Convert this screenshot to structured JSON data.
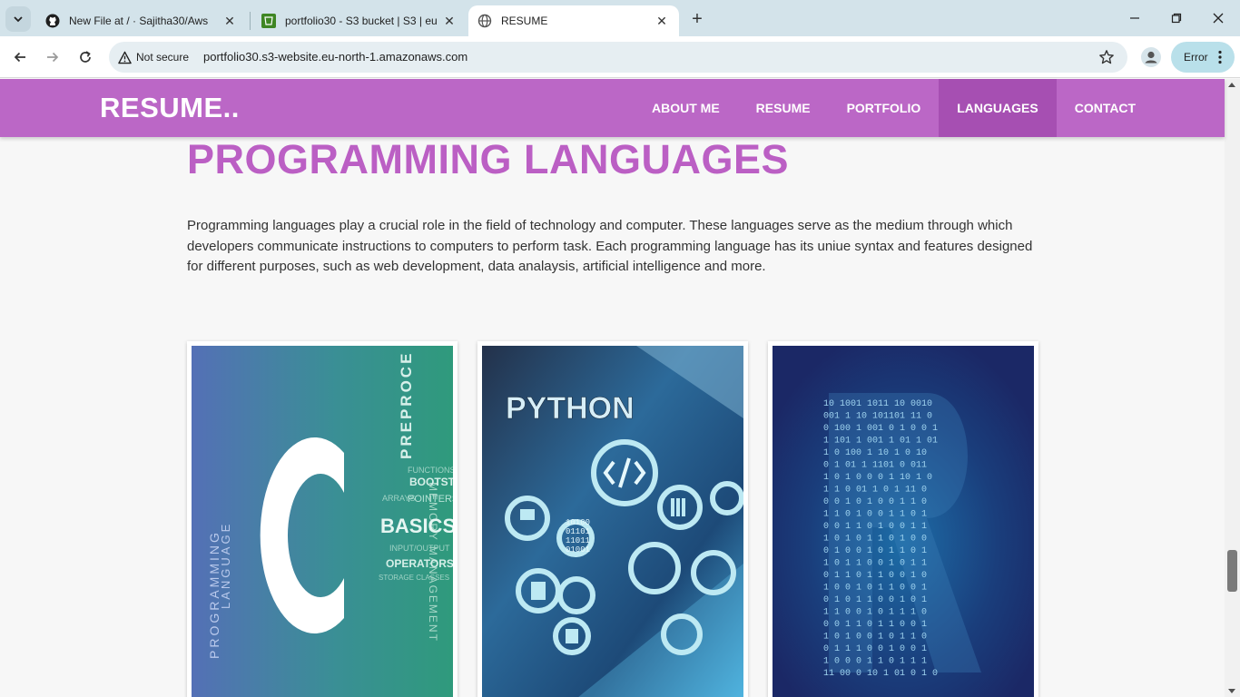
{
  "browser": {
    "tabs": [
      {
        "title": "New File at / · Sajitha30/Aws",
        "icon": "github-icon"
      },
      {
        "title": "portfolio30 - S3 bucket | S3 | eu",
        "icon": "aws-s3-icon"
      },
      {
        "title": "RESUME",
        "icon": "globe-icon"
      }
    ],
    "security_label": "Not secure",
    "url": "portfolio30.s3-website.eu-north-1.amazonaws.com",
    "error_label": "Error"
  },
  "site": {
    "brand": "RESUME..",
    "nav": [
      {
        "label": "ABOUT ME"
      },
      {
        "label": "RESUME"
      },
      {
        "label": "PORTFOLIO"
      },
      {
        "label": "LANGUAGES"
      },
      {
        "label": "CONTACT"
      }
    ],
    "active_nav": "LANGUAGES",
    "accent_color": "#bb67c6",
    "heading_color": "#bb5fc4"
  },
  "main": {
    "heading": "PROGRAMMING LANGUAGES",
    "intro": "Programming languages play a crucial role in the field of technology and computer. These languages serve as the medium through which developers communicate instructions to computers to perform task. Each programming language has its uniue syntax and features designed for different purposes, such as web development, data analaysis, artificial intelligence and more.",
    "cards": [
      {
        "image": "c-language-image",
        "texts": {
          "programming": "PROGRAMMING",
          "language": "LANGUAGE",
          "preprocessor": "PREPROCE",
          "functions": "FUNCTIONS",
          "bootstrap": "BOOTSTRAP",
          "arrays": "ARRAYS",
          "pointers": "POINTERS",
          "basics": "BASICS",
          "input_output": "INPUT/OUTPUT",
          "operators": "OPERATORS",
          "storage": "STORAGE CLASSES",
          "memory": "MEMORY MANAGEMENT"
        }
      },
      {
        "image": "python-gears-image",
        "texts": {
          "python": "PYTHON",
          "binary1": "10100",
          "binary2": "01101",
          "binary3": "11011",
          "binary4": "01001"
        }
      },
      {
        "image": "r-binary-image",
        "texts": {
          "rows": [
            "10 1001 1011 10 0010",
            "001 1 10 101101 11 0",
            "0 100 1 001 0 1 0 0 1",
            "1 101 1 001 1 01 1 01",
            "1 0 100 1 10 1 0 10",
            "0 1 01 1 1101 0 011",
            "1 0 1 0 0 0 1 10 1 0",
            "1 1 0 01 1 0 1 11 0",
            "0 0 1 0 1 0 0 1 1 0",
            "1 1 0 1 0 0 1 1 0 1",
            "0 0 1 1 0 1 0 0 1 1",
            "1 0 1 0 1 1 0 1 0 0",
            "0 1 0 0 1 0 1 1 0 1",
            "1 0 1 1 0 0 1 0 1 1",
            "0 1 1 0 1 1 0 0 1 0",
            "1 0 0 1 0 1 1 0 0 1",
            "0 1 0 1 1 0 0 1 0 1",
            "1 1 0 0 1 0 1 1 1 0",
            "0 0 1 1 0 1 1 0 0 1",
            "1 0 1 0 0 1 0 1 1 0",
            "0 1 1 1 0 0 1 0 0 1",
            "1 0 0 0 1 1 0 1 1 1",
            "11 00 0 10 1 01 0 1 0"
          ]
        }
      }
    ]
  }
}
